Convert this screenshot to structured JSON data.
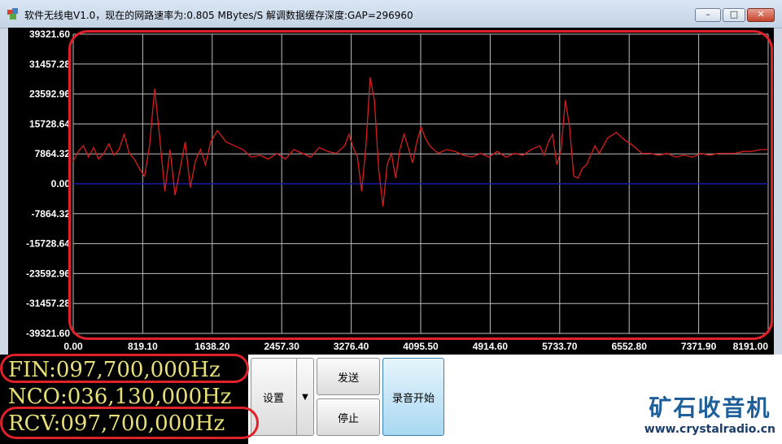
{
  "window": {
    "title": "软件无线电V1.0，现在的网路速率为:0.805 MBytes/S 解调数据缓存深度:GAP=296960",
    "buttons": [
      "minimize-icon",
      "maximize-icon",
      "close-icon"
    ]
  },
  "chart_data": {
    "type": "line",
    "title": "",
    "xlabel": "",
    "ylabel": "",
    "y_ticks": [
      "39321.60",
      "31457.28",
      "23592.96",
      "15728.64",
      "7864.32",
      "0.00",
      "-7864.32",
      "-15728.64",
      "-23592.96",
      "-31457.28",
      "-39321.60"
    ],
    "x_ticks": [
      "0.00",
      "819.10",
      "1638.20",
      "2457.30",
      "3276.40",
      "4095.50",
      "4914.60",
      "5733.70",
      "6552.80",
      "7371.90",
      "8191.00"
    ],
    "xlim": [
      0,
      8191
    ],
    "ylim": [
      -39321.6,
      39321.6
    ],
    "grid": true,
    "baseline_color": "#1a1aa8",
    "line_color": "#d81e1e",
    "series": [
      {
        "x": [
          0,
          60,
          120,
          180,
          240,
          300,
          360,
          420,
          480,
          540,
          600,
          660,
          720,
          780,
          840,
          900,
          960,
          1020,
          1080,
          1140,
          1200,
          1260,
          1320,
          1380,
          1440,
          1500,
          1560,
          1620,
          1700,
          1800,
          1900,
          2000,
          2100,
          2200,
          2300,
          2400,
          2500,
          2600,
          2700,
          2800,
          2900,
          3000,
          3100,
          3200,
          3250,
          3300,
          3350,
          3400,
          3450,
          3500,
          3550,
          3600,
          3650,
          3700,
          3750,
          3800,
          3850,
          3900,
          3950,
          4000,
          4050,
          4100,
          4150,
          4200,
          4300,
          4400,
          4500,
          4600,
          4700,
          4800,
          4900,
          5000,
          5100,
          5200,
          5300,
          5400,
          5500,
          5550,
          5600,
          5650,
          5700,
          5750,
          5800,
          5850,
          5900,
          5950,
          6000,
          6050,
          6100,
          6150,
          6200,
          6300,
          6400,
          6500,
          6600,
          6700,
          6800,
          6900,
          7000,
          7100,
          7200,
          7300,
          7400,
          7500,
          7600,
          7700,
          7800,
          7900,
          8000,
          8100,
          8191
        ],
        "values": [
          6000,
          8500,
          10000,
          7000,
          9500,
          6500,
          8000,
          10500,
          7500,
          9000,
          13000,
          8000,
          6500,
          4000,
          2000,
          10000,
          25000,
          12000,
          -2000,
          9000,
          -3000,
          4000,
          11000,
          -1000,
          6000,
          9000,
          5000,
          11000,
          14000,
          11000,
          10000,
          9000,
          7000,
          7500,
          6500,
          8000,
          6500,
          9000,
          8000,
          7000,
          9500,
          8500,
          8000,
          10000,
          13000,
          9500,
          7000,
          -2000,
          10000,
          28000,
          22000,
          4000,
          -6000,
          5000,
          8000,
          1500,
          9000,
          13000,
          9500,
          5500,
          11000,
          15000,
          12000,
          10000,
          8000,
          9000,
          8500,
          7500,
          7000,
          8000,
          7000,
          8500,
          7000,
          8000,
          7500,
          9000,
          10000,
          7500,
          11000,
          13000,
          5000,
          9000,
          22000,
          15000,
          2000,
          1500,
          4000,
          5000,
          7500,
          10000,
          8000,
          12000,
          13500,
          11500,
          10000,
          8000,
          8000,
          7500,
          8000,
          7000,
          7500,
          7000,
          8000,
          7500,
          8000,
          8000,
          8000,
          8500,
          8500,
          9000,
          9000
        ]
      }
    ]
  },
  "freq": {
    "fin": "FIN:097,700,000Hz",
    "nco": "NCO:036,130,000Hz",
    "rcv": "RCV:097,700,000Hz"
  },
  "controls": {
    "settings_label": "设置",
    "send_label": "发送",
    "stop_label": "停止",
    "record_label": "录音开始"
  },
  "brand": {
    "name": "矿石收音机",
    "url": "www.crystalradio.cn"
  }
}
